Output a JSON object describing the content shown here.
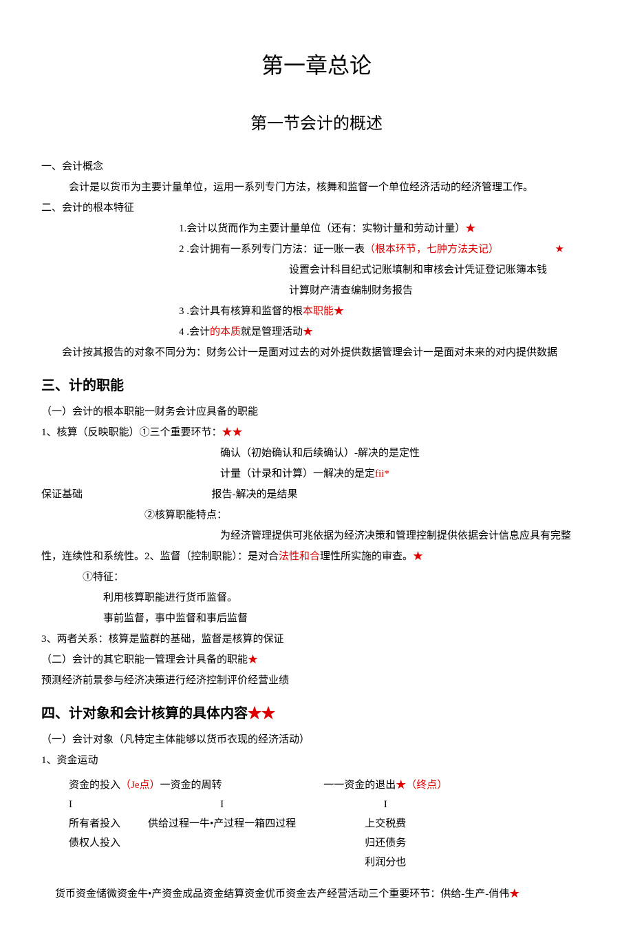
{
  "chapter_title": "第一章总论",
  "section_title": "第一节会计的概述",
  "s1": {
    "h": "一、会计概念",
    "p1": "会计是以货币为主要计量单位，运用一系列专门方法，核舞和监督一个单位经济活动的经济管理工作。"
  },
  "s2": {
    "h": "二、会计的根本特征",
    "li1": "1.会计以货而作为主要计量单位（还有：实物计量和劳动计量）",
    "li2a": "2 .会计拥有一系列专门方法：证一账一表",
    "li2b": "（根本环节，七肿方法夫记）",
    "li2_sub1": "设置会计科目纪式记账填制和审核会计凭证登记账簿本钱",
    "li2_sub2": "计算财产清查编制财务报告",
    "li3a": "3 .会计具有核算和监督的根",
    "li3b": "本职能",
    "li4a": "4 .会计",
    "li4b": "的本质",
    "li4c": "就是管理活动",
    "p_last": "会计按其报告的对象不同分为：财务公计一是面对过去的对外提供数据管理会计一是面对未来的对内提供数据"
  },
  "s3": {
    "h": "三、计的职能",
    "p1": "（一）会计的根本职能一财务会计应具备的职能",
    "p2": "1、核算（反映职能）①三个重要环节：",
    "p2_stars": "★★",
    "p3": "确认（初始确认和后续确认）-解决的是定性",
    "p4a": "计量（计录和计算）一解决的是定",
    "p4b": "fii*",
    "p5a": "保证基础",
    "p5b": "报告-解决的是结果",
    "p6": "②核算职能特点：",
    "p7a": "为经济管理提供可兆依据为经济决策和管理控制提供依据会计信息应具有完整",
    "p7b": "性，连续性和系统性。2、监督（控制职能）：是对合",
    "p7c": "法性和合",
    "p7d": "理性所实施的审查。",
    "p8": "①特征：",
    "p9": "利用核算职能进行货币监督。",
    "p10": "事前监督，事中监督和事后监督",
    "p11": "3、两者关系：核算是监群的基础，监督是核算的保证",
    "p12": "（二）会计的其它职能一管理会计具备的职能",
    "p13": "预测经济前景参与经济决策进行经济控制评价经营业绩"
  },
  "s4": {
    "h": "四、计对象和会计核算的具体内容",
    "h_stars": "★★",
    "p1": "（一）会计对象（凡特定主体能够以货币衣现的经济活动）",
    "p2": "1、资金运动",
    "r1c1a": "资金的投入",
    "r1c1b": "（Je点）",
    "r1c1c": "一资金的周转",
    "r1c2a": "一一资金的退出",
    "r1c2b": "★（终点）",
    "r2c1": "I",
    "r2c2": "I",
    "r2c3": "I",
    "r3c1": "所有者投入",
    "r3c2": "供给过程一牛•产过程一箱四过程",
    "r3c3": "上交税费",
    "r4c1": "债权人投入",
    "r4c3": "归还债务",
    "r5c3": "利润分也",
    "p_last": "货币资金储微资金牛•产资金成品资金结算资金优币资金去产经营活动三个重要环节：供给-生产-俏伟"
  },
  "star": "★"
}
